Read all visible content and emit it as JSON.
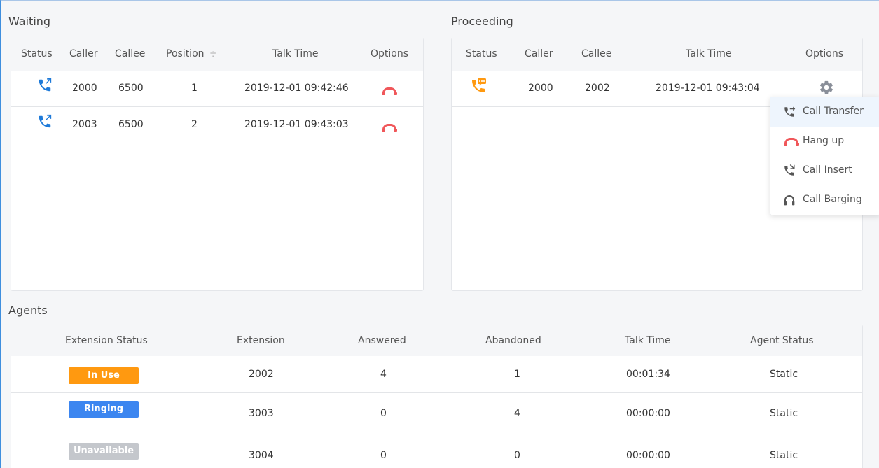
{
  "colors": {
    "accent_blue": "#1e7ad9",
    "in_use_orange": "#ff9910",
    "ringing_blue": "#3c86f0",
    "unavailable_gray": "#c4c7cc",
    "hangup_red": "#f0575a"
  },
  "waiting": {
    "title": "Waiting",
    "headers": {
      "status": "Status",
      "caller": "Caller",
      "callee": "Callee",
      "position": "Position",
      "sort_icon": "≑",
      "talk_time": "Talk Time",
      "options": "Options"
    },
    "rows": [
      {
        "status_icon": "incoming-call-icon",
        "caller": "2000",
        "callee": "6500",
        "position": "1",
        "talk_time": "2019-12-01 09:42:46",
        "option_icon": "hang-up-icon"
      },
      {
        "status_icon": "incoming-call-icon",
        "caller": "2003",
        "callee": "6500",
        "position": "2",
        "talk_time": "2019-12-01 09:43:03",
        "option_icon": "hang-up-icon"
      }
    ]
  },
  "proceeding": {
    "title": "Proceeding",
    "headers": {
      "status": "Status",
      "caller": "Caller",
      "callee": "Callee",
      "talk_time": "Talk Time",
      "options": "Options"
    },
    "rows": [
      {
        "status_icon": "talking-call-icon",
        "caller": "2000",
        "callee": "2002",
        "talk_time": "2019-12-01 09:43:04",
        "option_icon": "gear-icon"
      }
    ],
    "options_menu": [
      {
        "label": "Call Transfer",
        "icon": "call-transfer-icon",
        "active": true
      },
      {
        "label": "Hang up",
        "icon": "hang-up-icon",
        "active": false
      },
      {
        "label": "Call Insert",
        "icon": "call-insert-icon",
        "active": false
      },
      {
        "label": "Call Barging",
        "icon": "headset-icon",
        "active": false
      }
    ]
  },
  "agents": {
    "title": "Agents",
    "headers": {
      "extension_status": "Extension Status",
      "extension": "Extension",
      "answered": "Answered",
      "abandoned": "Abandoned",
      "talk_time": "Talk Time",
      "agent_status": "Agent Status"
    },
    "rows": [
      {
        "extension_status": "In Use",
        "extension": "2002",
        "answered": "4",
        "abandoned": "1",
        "talk_time": "00:01:34",
        "agent_status": "Static"
      },
      {
        "extension_status": "Ringing",
        "extension": "3003",
        "answered": "0",
        "abandoned": "4",
        "talk_time": "00:00:00",
        "agent_status": "Static"
      },
      {
        "extension_status": "Unavailable",
        "extension": "3004",
        "answered": "0",
        "abandoned": "0",
        "talk_time": "00:00:00",
        "agent_status": "Static"
      }
    ]
  }
}
